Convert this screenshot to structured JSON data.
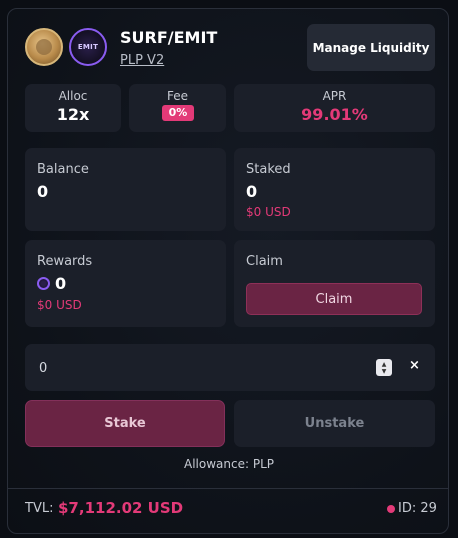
{
  "header": {
    "pair_title": "SURF/EMIT",
    "pool_version": "PLP V2",
    "manage_button": "Manage Liquidity",
    "token_b_logo_text": "EMIT"
  },
  "stats": {
    "alloc_label": "Alloc",
    "alloc_value": "12x",
    "fee_label": "Fee",
    "fee_value": "0%",
    "apr_label": "APR",
    "apr_value": "99.01%"
  },
  "balance": {
    "label": "Balance",
    "value": "0"
  },
  "staked": {
    "label": "Staked",
    "value": "0",
    "usd": "$0 USD"
  },
  "rewards": {
    "label": "Rewards",
    "value": "0",
    "usd": "$0 USD"
  },
  "claim": {
    "label": "Claim",
    "button": "Claim"
  },
  "amount_input": {
    "value": "0",
    "clear_symbol": "×"
  },
  "actions": {
    "stake": "Stake",
    "unstake": "Unstake"
  },
  "allowance_text": "Allowance: PLP",
  "footer": {
    "tvl_label": "TVL:",
    "tvl_value": "$7,112.02 USD",
    "id_text": "ID: 29"
  },
  "colors": {
    "accent": "#e33a78",
    "tile": "#1b1f29",
    "background": "#0b0e14"
  },
  "icons": [
    "surf-token-icon",
    "emit-token-icon",
    "emit-reward-icon",
    "spinner-up-icon",
    "spinner-down-icon",
    "clear-icon",
    "status-dot-icon"
  ]
}
